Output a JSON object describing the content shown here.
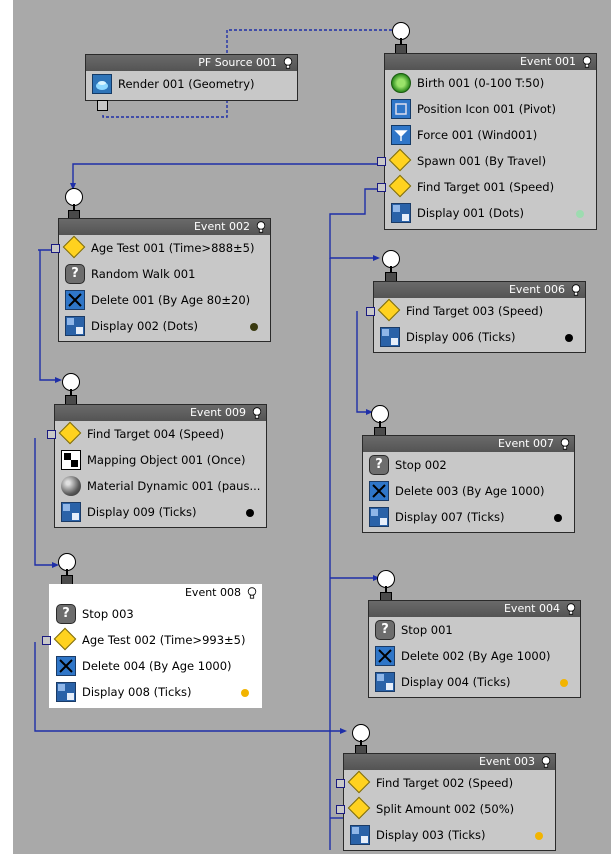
{
  "pf_source": {
    "title": "PF Source 001",
    "items": [
      {
        "label": "Render 001 (Geometry)"
      }
    ]
  },
  "event_001": {
    "title": "Event 001",
    "items": [
      {
        "label": "Birth 001 (0-100 T:50)"
      },
      {
        "label": "Position Icon 001 (Pivot)"
      },
      {
        "label": "Force 001 (Wind001)"
      },
      {
        "label": "Spawn 001 (By Travel)"
      },
      {
        "label": "Find Target 001 (Speed)"
      },
      {
        "label": "Display 001 (Dots)"
      }
    ],
    "display_color": "#9ddcb0"
  },
  "event_002": {
    "title": "Event 002",
    "items": [
      {
        "label": "Age Test 001 (Time>888±5)"
      },
      {
        "label": "Random Walk 001"
      },
      {
        "label": "Delete 001 (By Age 80±20)"
      },
      {
        "label": "Display 002 (Dots)"
      }
    ],
    "display_color": "#3a3a10"
  },
  "event_009": {
    "title": "Event 009",
    "items": [
      {
        "label": "Find Target 004 (Speed)"
      },
      {
        "label": "Mapping Object 001 (Once)"
      },
      {
        "label": "Material Dynamic 001 (paus..."
      },
      {
        "label": "Display 009 (Ticks)"
      }
    ],
    "display_color": "#000000"
  },
  "event_008": {
    "title": "Event 008",
    "items": [
      {
        "label": "Stop 003"
      },
      {
        "label": "Age Test 002 (Time>993±5)"
      },
      {
        "label": "Delete 004 (By Age 1000)"
      },
      {
        "label": "Display 008 (Ticks)"
      }
    ],
    "display_color": "#f2b400"
  },
  "event_006": {
    "title": "Event 006",
    "items": [
      {
        "label": "Find Target 003 (Speed)"
      },
      {
        "label": "Display 006 (Ticks)"
      }
    ],
    "display_color": "#000000"
  },
  "event_007": {
    "title": "Event 007",
    "items": [
      {
        "label": "Stop 002"
      },
      {
        "label": "Delete 003 (By Age 1000)"
      },
      {
        "label": "Display 007 (Ticks)"
      }
    ],
    "display_color": "#000000"
  },
  "event_004": {
    "title": "Event 004",
    "items": [
      {
        "label": "Stop 001"
      },
      {
        "label": "Delete 002 (By Age 1000)"
      },
      {
        "label": "Display 004 (Ticks)"
      }
    ],
    "display_color": "#f2b400"
  },
  "event_003": {
    "title": "Event 003",
    "items": [
      {
        "label": "Find Target 002 (Speed)"
      },
      {
        "label": "Split Amount 002 (50%)"
      },
      {
        "label": "Display 003 (Ticks)"
      }
    ],
    "display_color": "#f2b400"
  },
  "colors": {
    "canvas": "#a9a9a9",
    "wire": "#1f2fa8",
    "titlebar": "#5e5e5e",
    "node_body": "#c8c8c8"
  },
  "icons": {
    "render": "render-teapot-icon",
    "birth": "birth-icon",
    "position": "position-icon",
    "force": "force-icon",
    "test": "test-diamond-icon",
    "stop": "question-icon",
    "delete": "delete-x-icon",
    "display": "display-icon",
    "mapping": "mapping-icon",
    "material": "material-sphere-icon",
    "random_walk": "question-icon",
    "bulb": "bulb-icon"
  }
}
